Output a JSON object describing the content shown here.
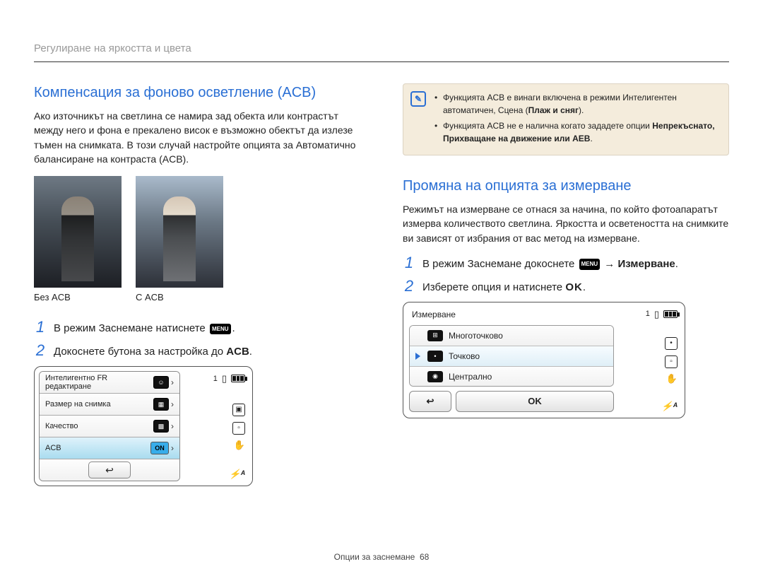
{
  "page_header": "Регулиране на яркостта и цвета",
  "left": {
    "heading": "Компенсация за фоново осветление (ACB)",
    "intro": "Ако източникът на светлина се намира зад обекта или контрастът между него и фона е прекалено висок е възможно обектът да излезе тъмен на снимката. В този случай настройте опцията за Автоматично балансиране на контраста (ACB).",
    "photo_without_label": "Без ACB",
    "photo_with_label": "С ACB",
    "step1_prefix": "В режим Заснемане натиснете ",
    "step1_suffix": ".",
    "menu_chip": "MENU",
    "step2_prefix": "Докоснете бутона за настройка до ",
    "step2_bold": "ACB",
    "step2_suffix": ".",
    "cam": {
      "row1": "Интелигентно FR редактиране",
      "row2": "Размер на снимка",
      "row3": "Качество",
      "row4": "ACB",
      "on": "ON",
      "counter": "1"
    }
  },
  "right": {
    "note1_prefix": "Функцията ACB е винаги включена в режими Интелигентен автоматичен, Сцена (",
    "note1_bold": "Плаж и сняг",
    "note1_suffix": ").",
    "note2_prefix": "Функцията ACB не е налична когато зададете опции ",
    "note2_bold": "Непрекъснато, Прихващане на движение или AEB",
    "note2_suffix": ".",
    "heading": "Промяна на опцията за измерване",
    "intro": "Режимът на измерване се отнася за начина, по който фотоапаратът измерва количеството светлина. Яркостта и осветеността на снимките ви зависят от избрания от вас метод на измерване.",
    "step1_prefix": "В режим Заснемане докоснете ",
    "menu_chip": "MENU",
    "step1_arrow": " → ",
    "step1_bold": "Измерване",
    "step1_suffix": ".",
    "step2_prefix": "Изберете опция и натиснете ",
    "step2_ok": "OK",
    "step2_suffix": ".",
    "screen": {
      "title": "Измерване",
      "opt1": "Многоточково",
      "opt2": "Точково",
      "opt3": "Централно",
      "ok": "OK",
      "counter": "1"
    }
  },
  "footer_label": "Опции за заснемане",
  "footer_page": "68"
}
